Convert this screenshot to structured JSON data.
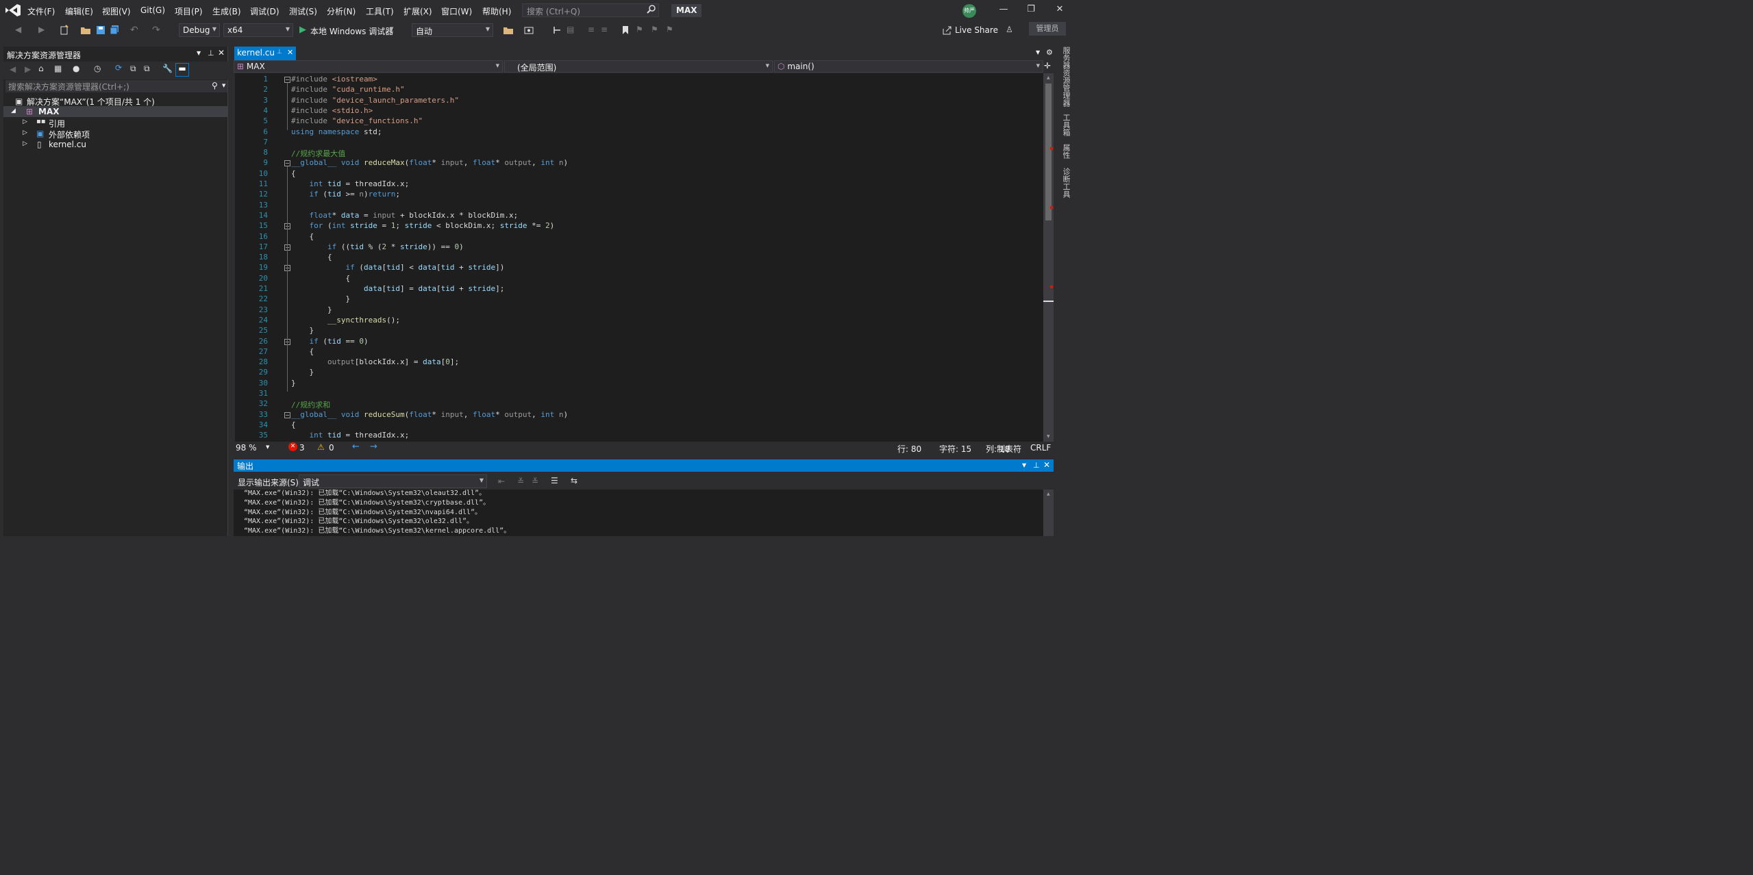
{
  "title_bar": {
    "menus": [
      "文件(F)",
      "编辑(E)",
      "视图(V)",
      "Git(G)",
      "项目(P)",
      "生成(B)",
      "调试(D)",
      "测试(S)",
      "分析(N)",
      "工具(T)",
      "扩展(X)",
      "窗口(W)",
      "帮助(H)"
    ],
    "search_placeholder": "搜索 (Ctrl+Q)",
    "project_name": "MAX",
    "avatar_text": "帅严"
  },
  "toolbar": {
    "config": "Debug",
    "platform": "x64",
    "run_label": "本地 Windows 调试器",
    "auto_label": "自动",
    "live_share": "Live Share",
    "admin": "管理员"
  },
  "solution_explorer": {
    "title": "解决方案资源管理器",
    "search_placeholder": "搜索解决方案资源管理器(Ctrl+;)",
    "solution": "解决方案“MAX”(1 个项目/共 1 个)",
    "project": "MAX",
    "items": [
      "引用",
      "外部依赖项",
      "kernel.cu"
    ]
  },
  "editor": {
    "tab": "kernel.cu",
    "nav_project": "MAX",
    "nav_scope": "(全局范围)",
    "nav_member": "main()"
  },
  "status": {
    "zoom": "98 %",
    "errors": "3",
    "warnings": "0",
    "line": "行: 80",
    "char": "字符: 15",
    "col": "列: 18",
    "tabs": "制表符",
    "eol": "CRLF"
  },
  "output": {
    "title": "输出",
    "source_label": "显示输出来源(S):",
    "source_value": "调试",
    "lines": [
      "“MAX.exe”(Win32): 已加载“C:\\Windows\\System32\\oleaut32.dll”。",
      "“MAX.exe”(Win32): 已加载“C:\\Windows\\System32\\cryptbase.dll”。",
      "“MAX.exe”(Win32): 已加载“C:\\Windows\\System32\\nvapi64.dll”。",
      "“MAX.exe”(Win32): 已加载“C:\\Windows\\System32\\ole32.dll”。",
      "“MAX.exe”(Win32): 已加载“C:\\Windows\\System32\\kernel.appcore.dll”。"
    ]
  },
  "right_rail": [
    "服务器资源管理器",
    "工具箱",
    "属性",
    "诊断工具"
  ],
  "code_lines": [
    "#include <iostream>",
    "#include \"cuda_runtime.h\"",
    "#include \"device_launch_parameters.h\"",
    "#include <stdio.h>",
    "#include \"device_functions.h\"",
    "using namespace std;",
    "",
    "//规约求最大值",
    "__global__ void reduceMax(float* input, float* output, int n)",
    "{",
    "    int tid = threadIdx.x;",
    "    if (tid >= n)return;",
    "",
    "    float* data = input + blockIdx.x * blockDim.x;",
    "    for (int stride = 1; stride < blockDim.x; stride *= 2)",
    "    {",
    "        if ((tid % (2 * stride)) == 0)",
    "        {",
    "            if (data[tid] < data[tid + stride])",
    "            {",
    "                data[tid] = data[tid + stride];",
    "            }",
    "        }",
    "        __syncthreads();",
    "    }",
    "    if (tid == 0)",
    "    {",
    "        output[blockIdx.x] = data[0];",
    "    }",
    "}",
    "",
    "//规约求和",
    "__global__ void reduceSum(float* input, float* output, int n)",
    "{",
    "    int tid = threadIdx.x;"
  ]
}
